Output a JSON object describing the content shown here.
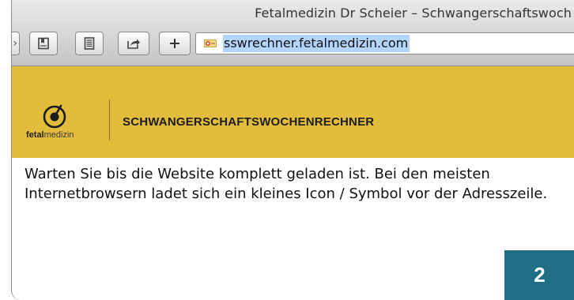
{
  "browser": {
    "window_title": "Fetalmedizin Dr Scheier – Schwangerschaftswoch",
    "address_url": "sswrechner.fetalmedizin.com",
    "toolbar_icons": [
      "back-icon",
      "bookmarks-icon",
      "reader-icon",
      "share-icon",
      "plus-icon"
    ],
    "favicon_icon": "favicon-icon"
  },
  "site": {
    "logo_text_bold": "fetal",
    "logo_text_rest": "medizin",
    "header_title": "SCHWANGERSCHAFTSWOCHENRECHNER",
    "banner_color": "#e2bc3b"
  },
  "instruction": {
    "text": "Warten Sie bis die Website komplett geladen ist. Bei den meisten Internetbrowsern ladet sich ein kleines Icon / Symbol vor der Adresszeile."
  },
  "step": {
    "number": "2",
    "badge_color": "#1f6e86"
  }
}
